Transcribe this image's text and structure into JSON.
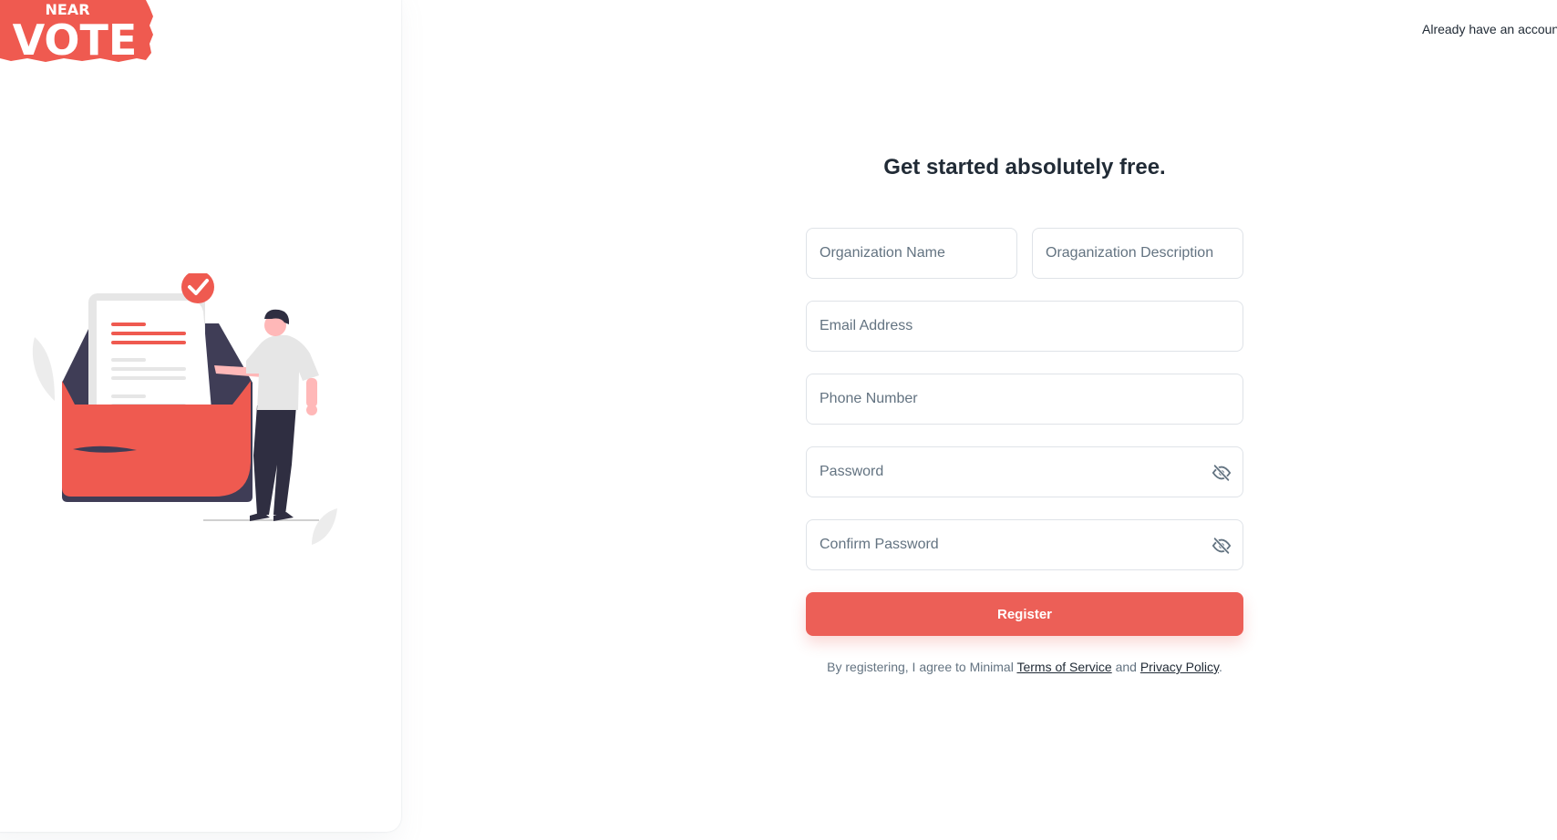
{
  "logo": {
    "top_text": "NEAR",
    "main_text": "VOTE",
    "color": "#ef5a50"
  },
  "header": {
    "login_prompt": "Already have an account?"
  },
  "form": {
    "title": "Get started absolutely free.",
    "org_name_placeholder": "Organization Name",
    "org_desc_placeholder": "Oraganization Description",
    "email_placeholder": "Email Address",
    "phone_placeholder": "Phone Number",
    "password_placeholder": "Password",
    "confirm_password_placeholder": "Confirm Password",
    "password_icon": "eye-off-icon",
    "register_label": "Register"
  },
  "terms": {
    "prefix": "By registering, I agree to Minimal ",
    "tos_label": "Terms of Service",
    "middle": " and ",
    "privacy_label": "Privacy Policy",
    "suffix": "."
  },
  "colors": {
    "accent": "#ec5f57",
    "text_primary": "#212b36",
    "text_secondary": "#637381",
    "border": "#dfe3e8"
  }
}
